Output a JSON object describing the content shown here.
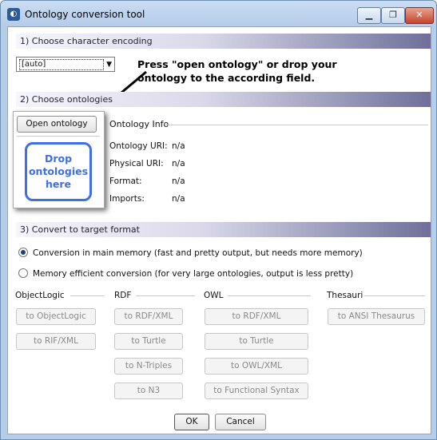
{
  "window": {
    "title": "Ontology conversion tool",
    "minimize": "▁",
    "maximize": "❐",
    "close": "✕",
    "app_icon": "ontology-app-icon"
  },
  "section1": {
    "header": "1) Choose character encoding",
    "encoding_value": "[auto]"
  },
  "hint": {
    "text": "Press \"open ontology\" or drop your ontology to the according field."
  },
  "section2": {
    "header": "2) Choose ontologies",
    "open_button": "Open ontology",
    "drop_zone": "Drop ontologies here",
    "info_title": "Ontology Info",
    "fields": [
      {
        "label": "Ontology URI:",
        "value": "n/a"
      },
      {
        "label": "Physical URI:",
        "value": "n/a"
      },
      {
        "label": "Format:",
        "value": "n/a"
      },
      {
        "label": "Imports:",
        "value": "n/a"
      }
    ]
  },
  "section3": {
    "header": "3) Convert to target format",
    "option_main": "Conversion in main memory (fast and pretty output, but needs more memory)",
    "option_efficient": "Memory efficient conversion (for very large ontologies, output is less pretty)",
    "selected": "main",
    "groups": {
      "objectlogic": {
        "label": "ObjectLogic",
        "buttons": [
          "to ObjectLogic",
          "to RIF/XML"
        ]
      },
      "rdf": {
        "label": "RDF",
        "buttons": [
          "to RDF/XML",
          "to Turtle",
          "to N-Triples",
          "to N3"
        ]
      },
      "owl": {
        "label": "OWL",
        "buttons": [
          "to RDF/XML",
          "to Turtle",
          "to OWL/XML",
          "to Functional Syntax"
        ]
      },
      "thesauri": {
        "label": "Thesauri",
        "buttons": [
          "to ANSI Thesaurus"
        ]
      }
    }
  },
  "footer": {
    "ok": "OK",
    "cancel": "Cancel"
  }
}
